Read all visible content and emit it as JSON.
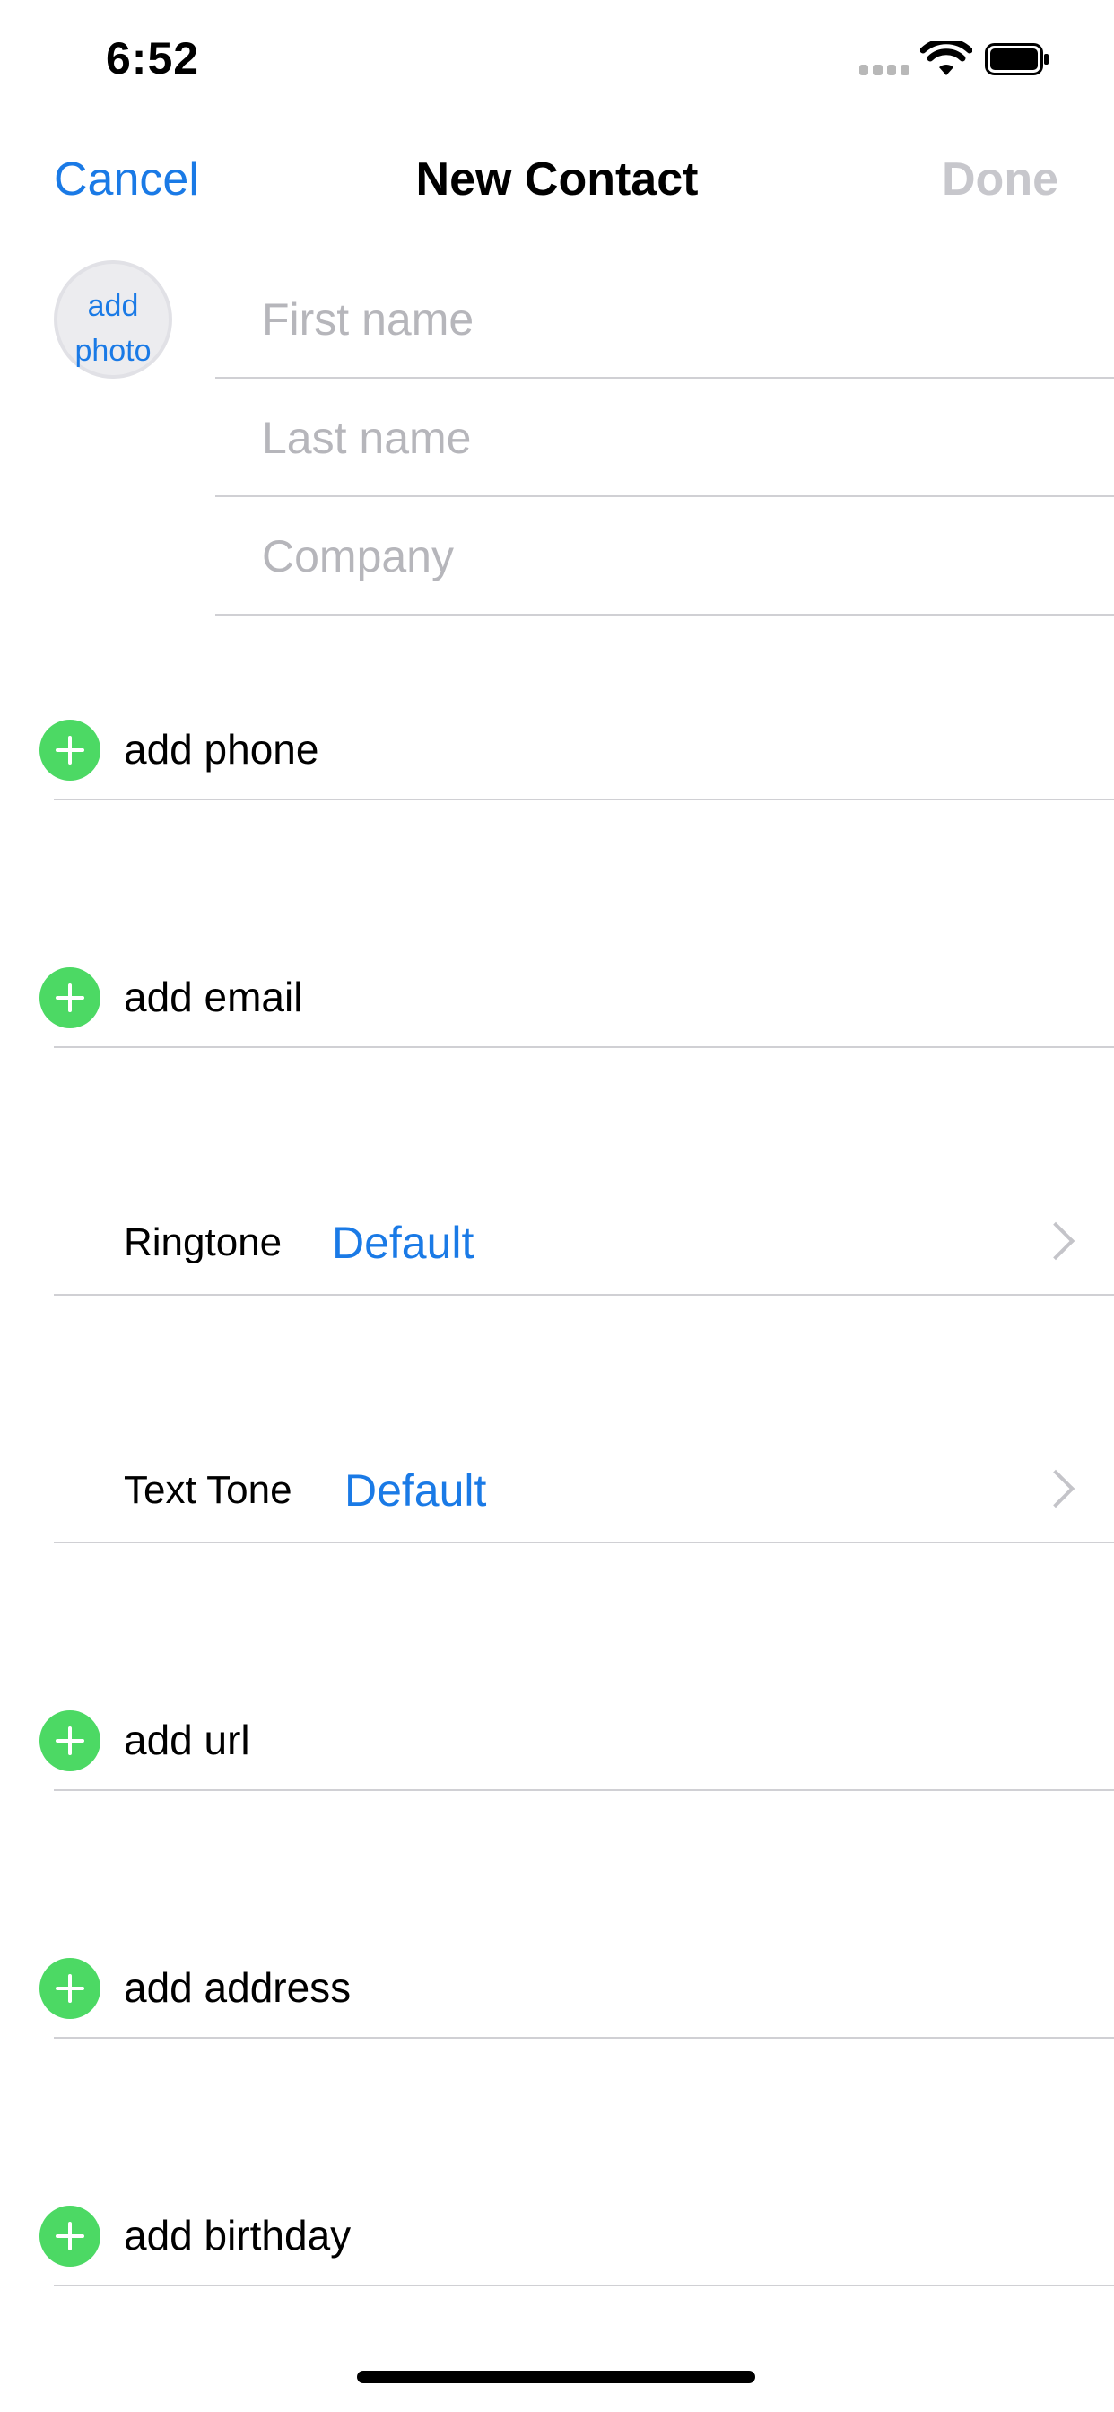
{
  "status_bar": {
    "time": "6:52"
  },
  "nav": {
    "cancel_label": "Cancel",
    "title": "New Contact",
    "done_label": "Done"
  },
  "avatar": {
    "label": "add photo"
  },
  "fields": {
    "first_name_placeholder": "First name",
    "last_name_placeholder": "Last name",
    "company_placeholder": "Company",
    "first_name_value": "",
    "last_name_value": "",
    "company_value": ""
  },
  "rows": {
    "add_phone": "add phone",
    "add_email": "add email",
    "ringtone_label": "Ringtone",
    "ringtone_value": "Default",
    "text_tone_label": "Text Tone",
    "text_tone_value": "Default",
    "add_url": "add url",
    "add_address": "add address",
    "add_birthday": "add birthday"
  },
  "colors": {
    "accent": "#1a7ae6",
    "add_green": "#4cd964",
    "disabled": "#c7c7cc",
    "separator": "#d0d0d4",
    "placeholder": "#b6b6bb"
  }
}
